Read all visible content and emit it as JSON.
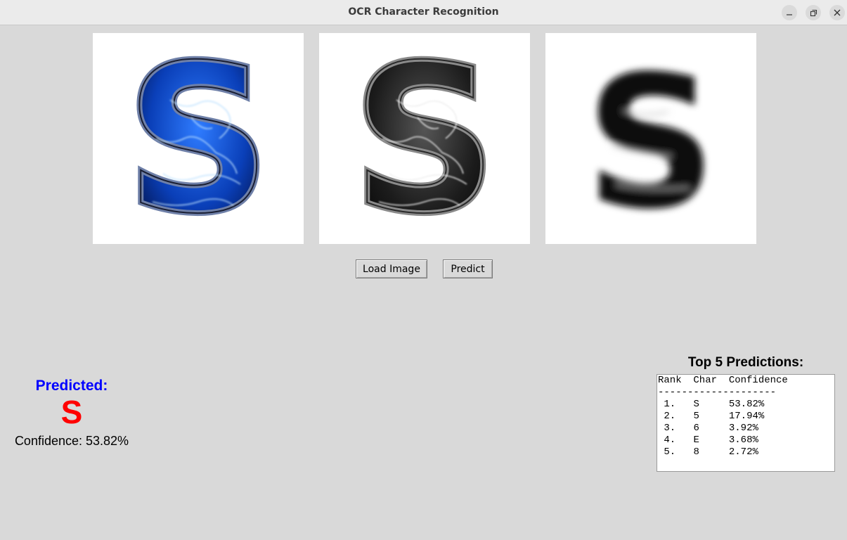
{
  "window": {
    "title": "OCR Character Recognition",
    "controls": [
      "minimize-icon",
      "restore-icon",
      "close-icon"
    ]
  },
  "images": [
    {
      "glyph": "S",
      "style": "color-electric-blue"
    },
    {
      "glyph": "S",
      "style": "grayscale"
    },
    {
      "glyph": "S",
      "style": "blurred"
    }
  ],
  "buttons": {
    "load_label": "Load Image",
    "predict_label": "Predict"
  },
  "result": {
    "label": "Predicted:",
    "character": "S",
    "confidence_text": "Confidence: 53.82%"
  },
  "top5": {
    "title": "Top 5 Predictions:",
    "header_line": "Rank  Char  Confidence",
    "separator": "--------------------",
    "rows": [
      {
        "rank": "1.",
        "char": "S",
        "confidence": "53.82%"
      },
      {
        "rank": "2.",
        "char": "5",
        "confidence": "17.94%"
      },
      {
        "rank": "3.",
        "char": "6",
        "confidence": "3.92%"
      },
      {
        "rank": "4.",
        "char": "E",
        "confidence": "3.68%"
      },
      {
        "rank": "5.",
        "char": "8",
        "confidence": "2.72%"
      }
    ]
  },
  "colors": {
    "background": "#d9d9d9",
    "predicted_label": "#0000ff",
    "predicted_char": "#ff0000"
  }
}
